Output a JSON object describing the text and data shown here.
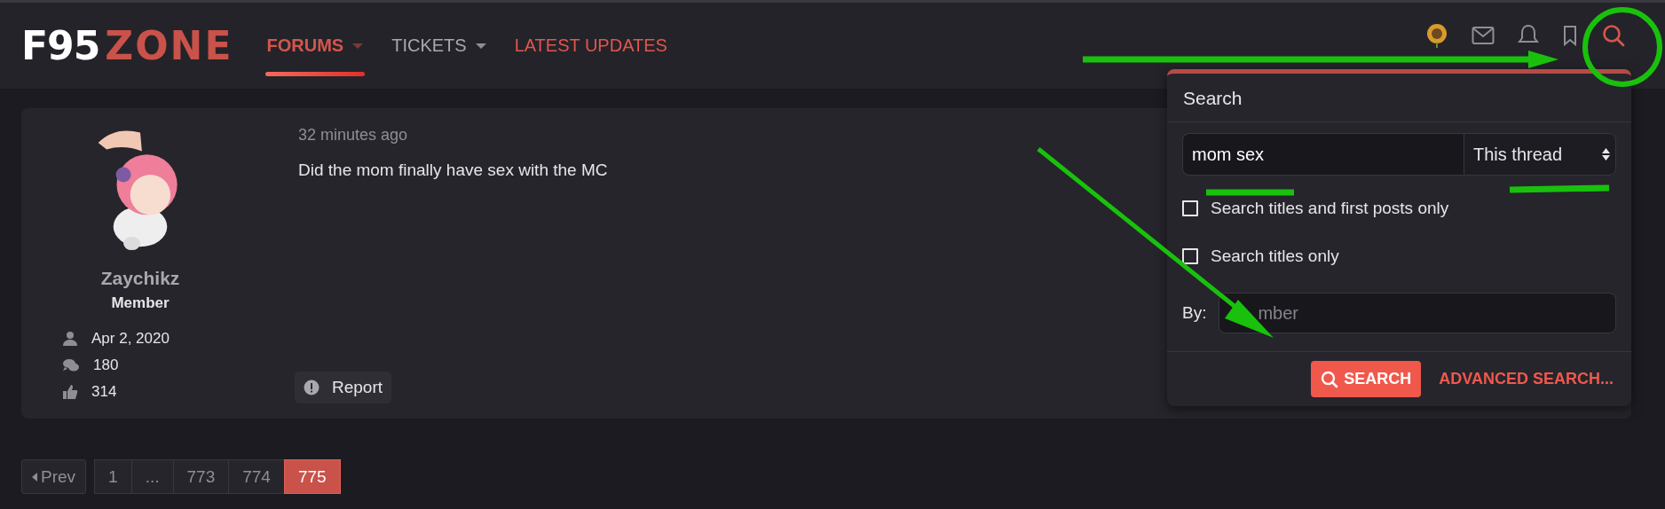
{
  "logo": {
    "primary": "F95",
    "secondary": "ZONE"
  },
  "nav": [
    {
      "label": "FORUMS",
      "kind": "menu",
      "selected": true
    },
    {
      "label": "TICKETS",
      "kind": "menu",
      "selected": false
    },
    {
      "label": "LATEST UPDATES",
      "kind": "link",
      "selected": false
    }
  ],
  "post": {
    "author": "Zaychikz",
    "role": "Member",
    "time": "32 minutes ago",
    "message": "Did the mom finally have sex with the MC",
    "report": "Report",
    "stats": [
      {
        "kind": "joined",
        "value": "Apr 2, 2020"
      },
      {
        "kind": "messages",
        "value": "180"
      },
      {
        "kind": "reactions",
        "value": "314"
      }
    ]
  },
  "pagination": {
    "prev": "Prev",
    "pages": [
      {
        "label": "1",
        "selected": false
      },
      {
        "label": "...",
        "selected": false
      },
      {
        "label": "773",
        "selected": false
      },
      {
        "label": "774",
        "selected": false
      },
      {
        "label": "775",
        "selected": true
      }
    ]
  },
  "search_popup": {
    "title": "Search",
    "query": "mom sex",
    "scope": "This thread",
    "options": [
      {
        "label": "Search titles and first posts only",
        "checked": false
      },
      {
        "label": "Search titles only",
        "checked": false
      }
    ],
    "by_label": "By:",
    "by_placeholder": "mber",
    "search_button": "SEARCH",
    "advanced_link": "ADVANCED SEARCH..."
  }
}
